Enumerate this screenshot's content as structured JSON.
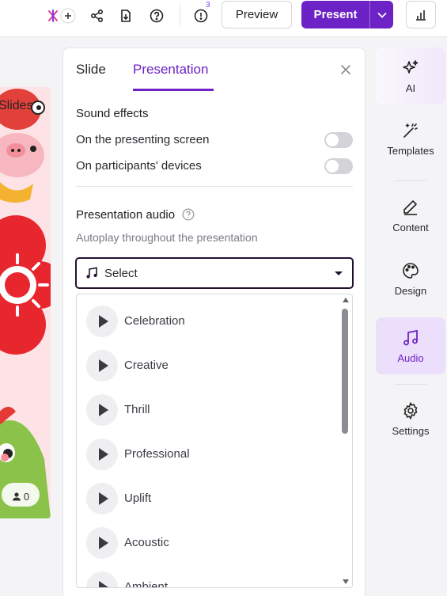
{
  "toolbar": {
    "notifications_badge": "3",
    "preview_label": "Preview",
    "present_label": "Present"
  },
  "panel": {
    "tabs": [
      {
        "label": "Slide",
        "active": false
      },
      {
        "label": "Presentation",
        "active": true
      }
    ],
    "sound_effects": {
      "heading": "Sound effects",
      "rows": [
        {
          "label": "On the presenting screen",
          "enabled": false
        },
        {
          "label": "On participants' devices",
          "enabled": false
        }
      ]
    },
    "presentation_audio": {
      "heading": "Presentation audio",
      "description": "Autoplay throughout the presentation",
      "select_value": "Select",
      "options": [
        "Celebration",
        "Creative",
        "Thrill",
        "Professional",
        "Uplift",
        "Acoustic",
        "Ambient"
      ]
    }
  },
  "rail": {
    "items": [
      {
        "label": "AI",
        "icon": "sparkle-icon"
      },
      {
        "label": "Templates",
        "icon": "magic-wand-icon"
      },
      {
        "label": "Content",
        "icon": "pencil-icon"
      },
      {
        "label": "Design",
        "icon": "palette-icon"
      },
      {
        "label": "Audio",
        "icon": "music-note-icon",
        "active": true
      },
      {
        "label": "Settings",
        "icon": "gear-icon"
      }
    ]
  },
  "slide": {
    "participants_count": "0",
    "logo_fragment": "Slides"
  },
  "colors": {
    "accent": "#6d22c5",
    "active_bg": "#ecdffb"
  }
}
